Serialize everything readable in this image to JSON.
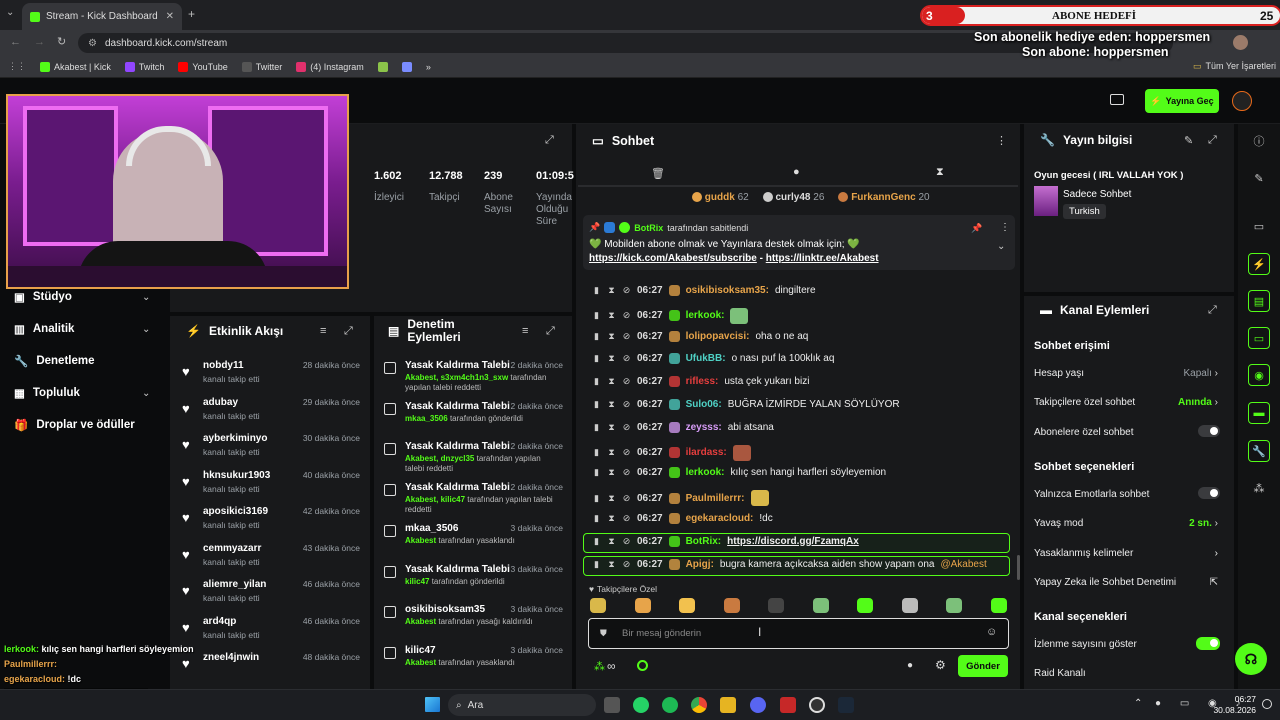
{
  "browser": {
    "tab_title": "Stream - Kick Dashboard",
    "url": "dashboard.kick.com/stream",
    "bookmarks": [
      "Akabest | Kick",
      "Twitch",
      "YouTube",
      "Twitter",
      "(4) Instagram"
    ],
    "all_bookmarks": "Tüm Yer İşaretleri"
  },
  "overlay": {
    "goal_count": "3",
    "goal_title": "ABONE HEDEFİ",
    "goal_target": "25",
    "last_gift": "Son abonelik hediye eden: hoppersmen",
    "last_sub": "Son abone: hoppersmen"
  },
  "header": {
    "go_live": "Yayına Geç"
  },
  "stats": [
    {
      "value": "1.602",
      "label": "İzleyici"
    },
    {
      "value": "12.788",
      "label": "Takipçi"
    },
    {
      "value": "239",
      "label": "Abone Sayısı"
    },
    {
      "value": "01:09:5",
      "label": "Yayında Olduğu Süre"
    }
  ],
  "sidebar": [
    "Stüdyo",
    "Analitik",
    "Denetleme",
    "Topluluk",
    "Droplar ve ödüller"
  ],
  "activity": {
    "title": "Etkinlik Akışı",
    "items": [
      {
        "name": "nobdy11",
        "sub": "kanalı takip etti",
        "time": "28 dakika önce"
      },
      {
        "name": "adubay",
        "sub": "kanalı takip etti",
        "time": "29 dakika önce"
      },
      {
        "name": "ayberkiminyo",
        "sub": "kanalı takip etti",
        "time": "30 dakika önce"
      },
      {
        "name": "hknsukur1903",
        "sub": "kanalı takip etti",
        "time": "40 dakika önce"
      },
      {
        "name": "aposikici3169",
        "sub": "kanalı takip etti",
        "time": "42 dakika önce"
      },
      {
        "name": "cemmyazarr",
        "sub": "kanalı takip etti",
        "time": "43 dakika önce"
      },
      {
        "name": "aliemre_yilan",
        "sub": "kanalı takip etti",
        "time": "46 dakika önce"
      },
      {
        "name": "ard4qp",
        "sub": "kanalı takip etti",
        "time": "46 dakika önce"
      },
      {
        "name": "zneel4jnwin",
        "sub": "",
        "time": "48 dakika önce"
      }
    ]
  },
  "moderation": {
    "title": "Denetim Eylemleri",
    "items": [
      {
        "name": "Yasak Kaldırma Talebi",
        "time": "2 dakika önce",
        "actor": "Akabest, s3xm4ch1n3_sxw",
        "rest": "tarafından yapılan talebi reddetti"
      },
      {
        "name": "Yasak Kaldırma Talebi",
        "time": "2 dakika önce",
        "actor": "mkaa_3506",
        "rest": "tarafından gönderildi"
      },
      {
        "name": "Yasak Kaldırma Talebi",
        "time": "2 dakika önce",
        "actor": "Akabest, dnzycl35",
        "rest": "tarafından yapılan talebi reddetti"
      },
      {
        "name": "Yasak Kaldırma Talebi",
        "time": "2 dakika önce",
        "actor": "Akabest, kilic47",
        "rest": "tarafından yapılan talebi reddetti"
      },
      {
        "name": "mkaa_3506",
        "time": "3 dakika önce",
        "actor": "Akabest",
        "rest": "tarafından yasaklandı"
      },
      {
        "name": "Yasak Kaldırma Talebi",
        "time": "3 dakika önce",
        "actor": "kilic47",
        "rest": "tarafından gönderildi"
      },
      {
        "name": "osikibisoksam35",
        "time": "3 dakika önce",
        "actor": "Akabest",
        "rest": "tarafından yasağı kaldırıldı"
      },
      {
        "name": "kilic47",
        "time": "3 dakika önce",
        "actor": "Akabest",
        "rest": "tarafından yasaklandı"
      }
    ]
  },
  "chat": {
    "title": "Sohbet",
    "top_gifters": [
      {
        "name": "guddk",
        "count": "62"
      },
      {
        "name": "curly48",
        "count": "26"
      },
      {
        "name": "FurkannGenc",
        "count": "20"
      }
    ],
    "pinned_by": "BotRix",
    "pinned_suffix": "tarafından sabitlendi",
    "pinned_text": "💚 Mobilden abone olmak ve Yayınlara destek olmak için; 💚",
    "pinned_link1": "https://kick.com/Akabest/subscribe",
    "pinned_sep": " - ",
    "pinned_link2": "https://linktr.ee/Akabest",
    "messages": [
      {
        "time": "06:27",
        "user": "osikibisoksam35",
        "color": "#e7a44a",
        "text": "dingiltere"
      },
      {
        "time": "06:27",
        "user": "lerkook",
        "color": "#53fc18",
        "text": ""
      },
      {
        "time": "06:27",
        "user": "lolipopavcisi",
        "color": "#e7a44a",
        "text": "oha o ne aq"
      },
      {
        "time": "06:27",
        "user": "UfukBB",
        "color": "#4fd1c5",
        "text": "o nası puf la 100klık aq"
      },
      {
        "time": "06:27",
        "user": "rifless",
        "color": "#e53e3e",
        "text": "usta çek yukarı bizi"
      },
      {
        "time": "06:27",
        "user": "Sulo06",
        "color": "#4fd1c5",
        "text": "BUĞRA İZMİRDE YALAN SÖYLÜYOR"
      },
      {
        "time": "06:27",
        "user": "zeysss",
        "color": "#d69cf6",
        "text": "abi atsana"
      },
      {
        "time": "06:27",
        "user": "ilardass",
        "color": "#e53e3e",
        "text": ""
      },
      {
        "time": "06:27",
        "user": "lerkook",
        "color": "#53fc18",
        "text": "kılıç sen hangi harfleri söyleyemion"
      },
      {
        "time": "06:27",
        "user": "Paulmillerrr",
        "color": "#e7a44a",
        "text": ""
      },
      {
        "time": "06:27",
        "user": "egekaracloud",
        "color": "#e7a44a",
        "text": "!dc"
      },
      {
        "time": "06:27",
        "user": "BotRix",
        "color": "#53fc18",
        "text": "https://discord.gg/FzamqAx"
      },
      {
        "time": "06:27",
        "user": "Apigj",
        "color": "#e7a44a",
        "text": "bugra kamera açıkcaksa aiden show yapam ona ",
        "mention": "@Akabest"
      }
    ],
    "emote_section": "Takipçilere Özel",
    "input_placeholder": "Bir mesaj gönderin",
    "send": "Gönder"
  },
  "stream_info": {
    "title": "Yayın bilgisi",
    "stream_title": "Oyun gecesi ( IRL VALLAH YOK )",
    "category": "Sadece Sohbet",
    "tag": "Turkish"
  },
  "channel_actions": {
    "title": "Kanal Eylemleri",
    "chat_access": "Sohbet erişimi",
    "account_age": "Hesap yaşı",
    "account_age_val": "Kapalı",
    "followers_only": "Takipçilere özel sohbet",
    "followers_only_val": "Anında",
    "subs_only": "Abonelere özel sohbet",
    "chat_options": "Sohbet seçenekleri",
    "emote_only": "Yalnızca Emotlarla sohbet",
    "slow_mode": "Yavaş mod",
    "slow_mode_val": "2 sn.",
    "banned_words": "Yasaklanmış kelimeler",
    "ai_mod": "Yapay Zeka ile Sohbet Denetimi",
    "channel_options": "Kanal seçenekleri",
    "show_viewers": "İzlenme sayısını göster",
    "raid": "Raid Kanalı"
  },
  "stream_chat_overlay": [
    {
      "user": "lerkook",
      "text": "kılıç sen hangi harfleri söyleyemion"
    },
    {
      "user": "Paulmillerrr",
      "text": ""
    },
    {
      "user": "egekaracloud",
      "text": "!dc"
    },
    {
      "user": "BotRix",
      "text": "https://discord.gg/FzamqAx"
    },
    {
      "user": "Apigj",
      "text": "bugra kamera açıkcaksa aiden show yapam ona ",
      "mention": "@Akabest"
    }
  ],
  "taskbar": {
    "search": "Ara",
    "time": "06:27",
    "date": "30.08.2026"
  },
  "colors": {
    "accent": "#53fc18",
    "bg": "#0b0c0d",
    "panel": "#18191b"
  }
}
